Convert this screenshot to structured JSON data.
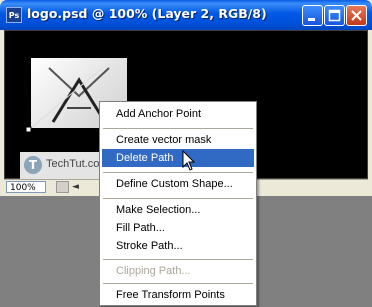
{
  "window": {
    "title": "logo.psd @ 100% (Layer 2, RGB/8)",
    "app_icon_text": "Ps"
  },
  "statusbar": {
    "zoom": "100%"
  },
  "watermark": {
    "text": "TechTut.com",
    "circle_letter": "T"
  },
  "context_menu": {
    "items": [
      {
        "label": "Add Anchor Point",
        "state": "normal"
      },
      {
        "label": "Create vector mask",
        "state": "normal"
      },
      {
        "label": "Delete Path",
        "state": "selected"
      },
      {
        "label": "Define Custom Shape...",
        "state": "normal"
      },
      {
        "label": "Make Selection...",
        "state": "normal"
      },
      {
        "label": "Fill Path...",
        "state": "normal"
      },
      {
        "label": "Stroke Path...",
        "state": "normal"
      },
      {
        "label": "Clipping Path...",
        "state": "disabled"
      },
      {
        "label": "Free Transform Points",
        "state": "normal"
      }
    ]
  },
  "colors": {
    "titlebar": "#0058e6",
    "selection": "#316ac5",
    "canvas": "#000000"
  }
}
